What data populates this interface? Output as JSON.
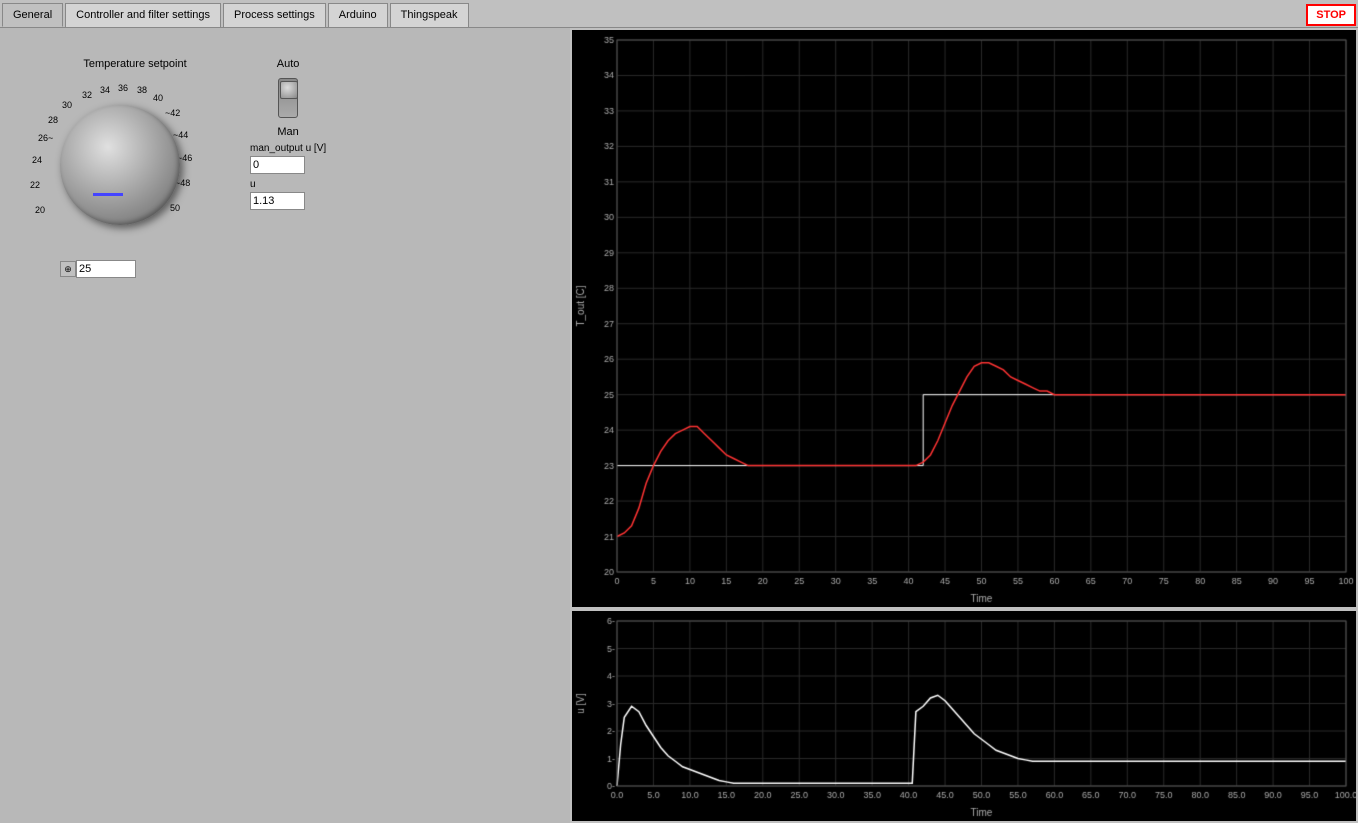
{
  "tabs": [
    {
      "label": "General",
      "active": true
    },
    {
      "label": "Controller and filter settings",
      "active": false
    },
    {
      "label": "Process settings",
      "active": false
    },
    {
      "label": "Arduino",
      "active": false
    },
    {
      "label": "Thingspeak",
      "active": false
    }
  ],
  "stop_button": "STOP",
  "knob": {
    "label": "Temperature setpoint",
    "value": "25",
    "scale_marks": [
      "20",
      "22",
      "24",
      "26~",
      "28",
      "30",
      "32",
      "34",
      "36",
      "38",
      "40",
      "~42",
      "~44",
      "~46",
      "~48",
      "50"
    ]
  },
  "auto_label": "Auto",
  "man_label": "Man",
  "man_output_label": "man_output u [V]",
  "man_output_value": "0",
  "u_label": "u",
  "u_value": "1.13",
  "chart_top": {
    "y_label": "T_out [C]",
    "x_label": "Time",
    "y_min": 20,
    "y_max": 35,
    "x_min": 0,
    "x_max": 100,
    "y_ticks": [
      20,
      21,
      22,
      23,
      24,
      25,
      26,
      27,
      28,
      29,
      30,
      31,
      32,
      33,
      34,
      35
    ],
    "x_ticks": [
      0,
      5,
      10,
      15,
      20,
      25,
      30,
      35,
      40,
      45,
      50,
      55,
      60,
      65,
      70,
      75,
      80,
      85,
      90,
      95,
      100
    ]
  },
  "chart_bottom": {
    "y_label": "u [V]",
    "x_label": "Time",
    "y_min": 0,
    "y_max": 6,
    "x_min": 0,
    "x_max": 100,
    "y_ticks": [
      0,
      1,
      2,
      3,
      4,
      5,
      6
    ],
    "x_ticks": [
      0,
      5,
      10,
      15,
      20,
      25,
      30,
      35,
      40,
      45,
      50,
      55,
      60,
      65,
      70,
      75,
      80,
      85,
      90,
      95,
      100
    ]
  },
  "colors": {
    "background": "#c0c0c0",
    "chart_bg": "#000000",
    "grid": "#333333",
    "curve_top": "#ff0000",
    "curve_bottom": "#ffffff",
    "tab_active": "#c0c0c0",
    "tab_inactive": "#d4d4d4"
  }
}
